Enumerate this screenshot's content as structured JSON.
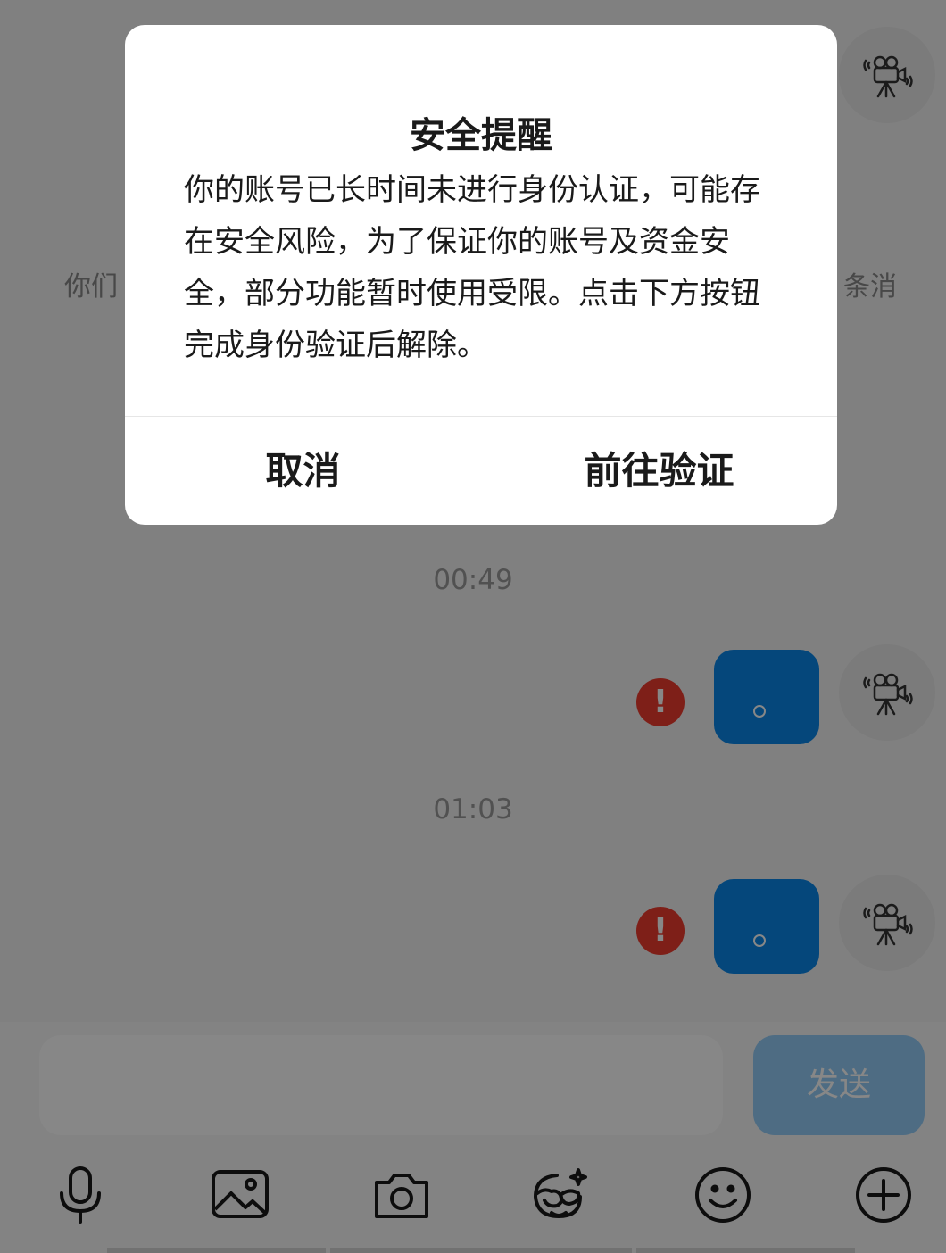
{
  "chat": {
    "side_text_left": "你们",
    "side_text_right": "条消",
    "timestamps": [
      "00:49",
      "01:03"
    ],
    "messages": [
      {
        "text": "。",
        "status": "failed"
      },
      {
        "text": "。",
        "status": "failed"
      }
    ],
    "error_mark": "!"
  },
  "composer": {
    "input_value": "",
    "send_label": "发送",
    "tools": [
      "microphone-icon",
      "image-icon",
      "camera-icon",
      "sticker-icon",
      "emoji-icon",
      "plus-icon"
    ]
  },
  "dialog": {
    "title": "安全提醒",
    "body": "你的账号已长时间未进行身份认证，可能存在安全风险，为了保证你的账号及资金安全，部分功能暂时使用受限。点击下方按钮完成身份验证后解除。",
    "cancel_label": "取消",
    "confirm_label": "前往验证"
  },
  "colors": {
    "bubble": "#0a86e8",
    "send_button": "#93cdf7",
    "error": "#ef3c2e",
    "overlay": "rgba(0,0,0,0.47)"
  }
}
